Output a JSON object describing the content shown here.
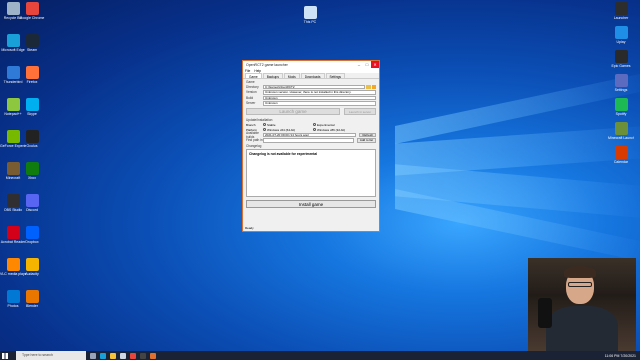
{
  "desktop": {
    "left_icons": [
      {
        "label": "Recycle Bin",
        "color": "#9fb3c8"
      },
      {
        "label": "Google Chrome",
        "color": "#e8453c"
      },
      {
        "label": "Microsoft Edge",
        "color": "#1aa0d8"
      },
      {
        "label": "Steam",
        "color": "#1b2838"
      },
      {
        "label": "Thunderbird",
        "color": "#2f7ad6"
      },
      {
        "label": "Firefox",
        "color": "#ff7139"
      },
      {
        "label": "Notepad++",
        "color": "#8dc63f"
      },
      {
        "label": "Skype",
        "color": "#00aff0"
      },
      {
        "label": "GeForce Experience",
        "color": "#76b900"
      },
      {
        "label": "Oculus",
        "color": "#222"
      },
      {
        "label": "Minecraft",
        "color": "#7a5c32"
      },
      {
        "label": "Xbox",
        "color": "#107c10"
      },
      {
        "label": "OBS Studio",
        "color": "#302e31"
      },
      {
        "label": "Discord",
        "color": "#5865f2"
      },
      {
        "label": "Acrobat Reader",
        "color": "#d4001a"
      },
      {
        "label": "Dropbox",
        "color": "#0061fe"
      },
      {
        "label": "VLC media player",
        "color": "#ff8800"
      },
      {
        "label": "Audacity",
        "color": "#f4b400"
      },
      {
        "label": "Photos",
        "color": "#0078d4"
      },
      {
        "label": "Blender",
        "color": "#ea7600"
      }
    ],
    "top_icon": {
      "label": "This PC",
      "color": "#cfe3f7"
    },
    "right_icons": [
      {
        "label": "Launcher",
        "color": "#2d2d2d"
      },
      {
        "label": "Uplay",
        "color": "#1f8ee6"
      },
      {
        "label": "Epic Games",
        "color": "#2a2a2a"
      },
      {
        "label": "Settings",
        "color": "#5c6bc0"
      },
      {
        "label": "Spotify",
        "color": "#1db954"
      },
      {
        "label": "Minecraft Launcher",
        "color": "#6c8f3a"
      },
      {
        "label": "Calendar",
        "color": "#d83b01"
      }
    ]
  },
  "window": {
    "title": "OpenRCT2 game launcher",
    "menu": [
      "File",
      "Help"
    ],
    "tabs": [
      "Game",
      "Backups",
      "Mods",
      "Downloads",
      "Settings"
    ],
    "section_game": "Game",
    "directory_label": "Directory",
    "directory_value": "C:\\Games\\OpenRCT2",
    "version_label": "Version",
    "version_value": "Unknown version. However, there is not installed in this directory.",
    "build_label": "Build",
    "build_value": "Unknown",
    "server_label": "Server",
    "server_value": "Unknown",
    "launch_label": "Launch game",
    "launch_side_label": "Launch in server",
    "section_update": "Update/Installation",
    "branch_label": "Branch",
    "branch_stable": "Stable",
    "branch_experimental": "Experimental",
    "platform_label": "Platform",
    "platform_a": "Windows x64 (64-bit)",
    "platform_b": "Windows x86 (32-bit)",
    "builds_label": "Available builds",
    "builds_value": "2021-07-20 09:00 (14 hours ago)",
    "refresh_label": "Refresh",
    "path_label": "Find path in",
    "add_label": "Add to list",
    "changelog_label": "Changelog",
    "changelog_text": "Changelog is not available for experimental",
    "install_label": "Install game",
    "status": "Ready"
  },
  "taskbar": {
    "search_placeholder": "Type here to search",
    "clock": "11:06 PM",
    "date": "7/20/2021"
  }
}
